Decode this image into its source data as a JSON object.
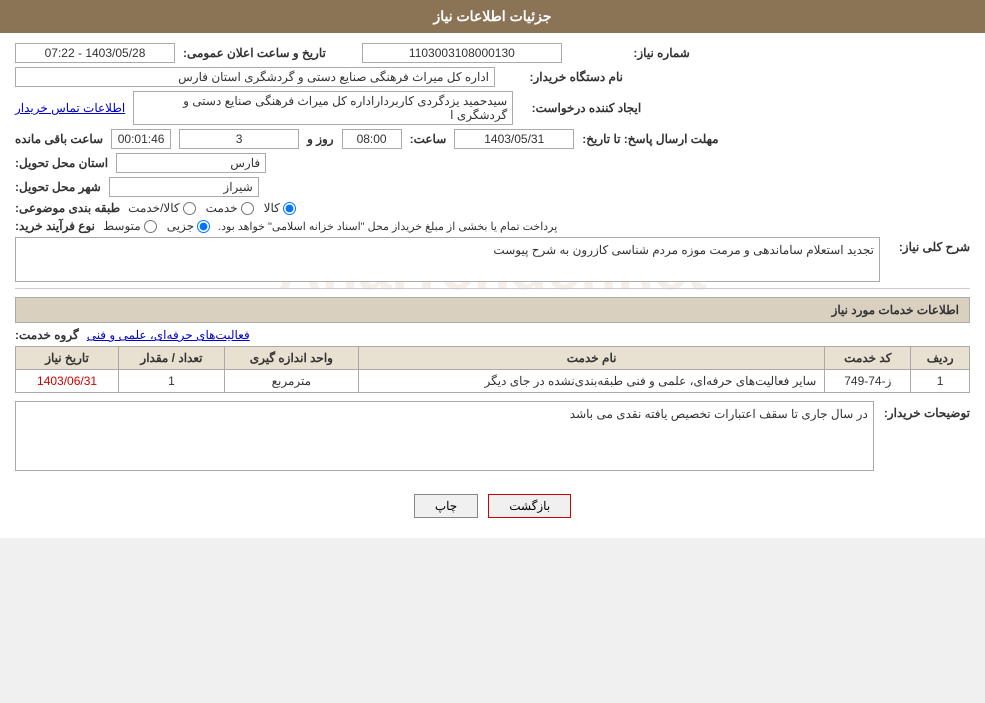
{
  "header": {
    "title": "جزئیات اطلاعات نیاز"
  },
  "fields": {
    "need_number_label": "شماره نیاز:",
    "need_number_value": "1103003108000130",
    "buyer_org_label": "نام دستگاه خریدار:",
    "buyer_org_value": "اداره کل میراث فرهنگی  صنایع دستی و گردشگری استان فارس",
    "creator_label": "ایجاد کننده درخواست:",
    "creator_value": "سیدحمید یزدگردی کاربرداراداره کل میراث فرهنگی  صنایع دستی و گردشگری ا",
    "creator_link": "اطلاعات تماس خریدار",
    "deadline_label": "مهلت ارسال پاسخ: تا تاریخ:",
    "deadline_date": "1403/05/31",
    "deadline_time_label": "ساعت:",
    "deadline_time": "08:00",
    "deadline_day_label": "روز و",
    "deadline_days": "3",
    "deadline_remaining_label": "ساعت باقی مانده",
    "deadline_remaining": "00:01:46",
    "announce_label": "تاریخ و ساعت اعلان عمومی:",
    "announce_value": "1403/05/28 - 07:22",
    "province_label": "استان محل تحویل:",
    "province_value": "فارس",
    "city_label": "شهر محل تحویل:",
    "city_value": "شیراز",
    "category_label": "طبقه بندی موضوعی:",
    "category_options": [
      "کالا",
      "خدمت",
      "کالا/خدمت"
    ],
    "category_selected": "کالا",
    "purchase_type_label": "نوع فرآیند خرید:",
    "purchase_type_options": [
      "جزیی",
      "متوسط"
    ],
    "purchase_type_note": "پرداخت تمام یا بخشی از مبلغ خریداز محل \"اسناد خزانه اسلامی\" خواهد بود.",
    "description_label": "شرح کلی نیاز:",
    "description_value": "تجدید  استعلام ساماندهی و مرمت موزه مردم شناسی کازرون به شرح پیوست"
  },
  "services_section": {
    "title": "اطلاعات خدمات مورد نیاز",
    "service_group_label": "گروه خدمت:",
    "service_group_value": "فعالیت‌های حرفه‌ای، علمی و فنی",
    "table": {
      "columns": [
        "ردیف",
        "کد خدمت",
        "نام خدمت",
        "واحد اندازه گیری",
        "تعداد / مقدار",
        "تاریخ نیاز"
      ],
      "rows": [
        {
          "row_num": "1",
          "code": "ز-74-749",
          "name": "سایر فعالیت‌های حرفه‌ای، علمی و فنی طبقه‌بندی‌نشده در جای دیگر",
          "unit": "مترمربع",
          "quantity": "1",
          "date": "1403/06/31"
        }
      ]
    }
  },
  "buyer_notes": {
    "label": "توضیحات خریدار:",
    "value": "در سال جاری تا سقف اعتبارات تخصیص یافته نقدی می باشد"
  },
  "buttons": {
    "print": "چاپ",
    "back": "بازگشت"
  }
}
